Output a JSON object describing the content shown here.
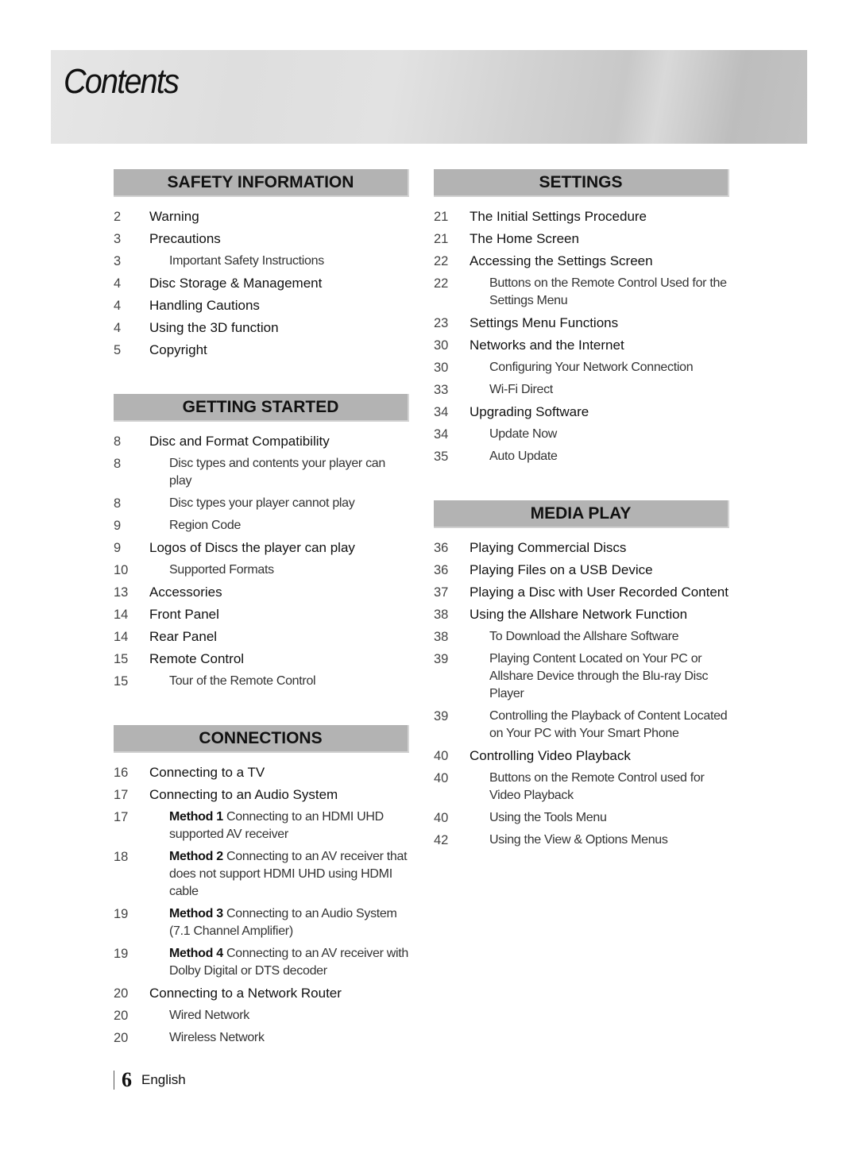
{
  "page_title": "Contents",
  "footer": {
    "page_number": "6",
    "language": "English"
  },
  "left_column": [
    {
      "heading": "SAFETY INFORMATION",
      "entries": [
        {
          "page": "2",
          "text": "Warning",
          "level": "main"
        },
        {
          "page": "3",
          "text": "Precautions",
          "level": "main"
        },
        {
          "page": "3",
          "text": "Important Safety Instructions",
          "level": "sub"
        },
        {
          "page": "4",
          "text": "Disc Storage & Management",
          "level": "main"
        },
        {
          "page": "4",
          "text": "Handling Cautions",
          "level": "main"
        },
        {
          "page": "4",
          "text": "Using the 3D function",
          "level": "main"
        },
        {
          "page": "5",
          "text": "Copyright",
          "level": "main"
        }
      ]
    },
    {
      "heading": "GETTING STARTED",
      "entries": [
        {
          "page": "8",
          "text": "Disc and Format Compatibility",
          "level": "main"
        },
        {
          "page": "8",
          "text": "Disc types and contents your player can play",
          "level": "sub"
        },
        {
          "page": "8",
          "text": "Disc types your player cannot play",
          "level": "sub"
        },
        {
          "page": "9",
          "text": "Region Code",
          "level": "sub"
        },
        {
          "page": "9",
          "text": "Logos of Discs the player can play",
          "level": "main"
        },
        {
          "page": "10",
          "text": "Supported Formats",
          "level": "sub"
        },
        {
          "page": "13",
          "text": "Accessories",
          "level": "main"
        },
        {
          "page": "14",
          "text": "Front Panel",
          "level": "main"
        },
        {
          "page": "14",
          "text": "Rear Panel",
          "level": "main"
        },
        {
          "page": "15",
          "text": "Remote Control",
          "level": "main"
        },
        {
          "page": "15",
          "text": "Tour of the Remote Control",
          "level": "sub"
        }
      ]
    },
    {
      "heading": "CONNECTIONS",
      "entries": [
        {
          "page": "16",
          "text": "Connecting to a TV",
          "level": "main"
        },
        {
          "page": "17",
          "text": "Connecting to an Audio System",
          "level": "main"
        },
        {
          "page": "17",
          "prefix": "Method 1",
          "text": "Connecting to an HDMI UHD supported AV receiver",
          "level": "sub"
        },
        {
          "page": "18",
          "prefix": "Method 2",
          "text": "Connecting to an AV receiver that does not support HDMI UHD using HDMI cable",
          "level": "sub"
        },
        {
          "page": "19",
          "prefix": "Method 3",
          "text": "Connecting to an Audio System (7.1 Channel Amplifier)",
          "level": "sub"
        },
        {
          "page": "19",
          "prefix": "Method 4",
          "text": "Connecting to an AV receiver with Dolby Digital or DTS decoder",
          "level": "sub"
        },
        {
          "page": "20",
          "text": "Connecting to a Network Router",
          "level": "main"
        },
        {
          "page": "20",
          "text": "Wired Network",
          "level": "sub"
        },
        {
          "page": "20",
          "text": "Wireless Network",
          "level": "sub"
        }
      ]
    }
  ],
  "right_column": [
    {
      "heading": "SETTINGS",
      "entries": [
        {
          "page": "21",
          "text": "The Initial Settings Procedure",
          "level": "main"
        },
        {
          "page": "21",
          "text": "The Home Screen",
          "level": "main"
        },
        {
          "page": "22",
          "text": "Accessing the Settings Screen",
          "level": "main"
        },
        {
          "page": "22",
          "text": "Buttons on the Remote Control Used for the Settings Menu",
          "level": "sub"
        },
        {
          "page": "23",
          "text": "Settings Menu Functions",
          "level": "main"
        },
        {
          "page": "30",
          "text": "Networks and the Internet",
          "level": "main"
        },
        {
          "page": "30",
          "text": "Configuring Your Network Connection",
          "level": "sub"
        },
        {
          "page": "33",
          "text": "Wi-Fi Direct",
          "level": "sub"
        },
        {
          "page": "34",
          "text": "Upgrading Software",
          "level": "main"
        },
        {
          "page": "34",
          "text": "Update Now",
          "level": "sub"
        },
        {
          "page": "35",
          "text": "Auto Update",
          "level": "sub"
        }
      ]
    },
    {
      "heading": "MEDIA PLAY",
      "entries": [
        {
          "page": "36",
          "text": "Playing Commercial Discs",
          "level": "main"
        },
        {
          "page": "36",
          "text": "Playing Files on a USB Device",
          "level": "main"
        },
        {
          "page": "37",
          "text": "Playing a Disc with User Recorded Content",
          "level": "main"
        },
        {
          "page": "38",
          "text": "Using the Allshare Network Function",
          "level": "main"
        },
        {
          "page": "38",
          "text": "To Download the Allshare Software",
          "level": "sub"
        },
        {
          "page": "39",
          "text": "Playing Content Located on Your PC or Allshare Device through the Blu-ray Disc Player",
          "level": "sub"
        },
        {
          "page": "39",
          "text": "Controlling the Playback of Content Located on Your PC with Your Smart Phone",
          "level": "sub"
        },
        {
          "page": "40",
          "text": "Controlling Video Playback",
          "level": "main"
        },
        {
          "page": "40",
          "text": "Buttons on the Remote Control used for Video Playback",
          "level": "sub"
        },
        {
          "page": "40",
          "text": "Using the Tools Menu",
          "level": "sub"
        },
        {
          "page": "42",
          "text": "Using the View & Options Menus",
          "level": "sub"
        }
      ]
    }
  ]
}
